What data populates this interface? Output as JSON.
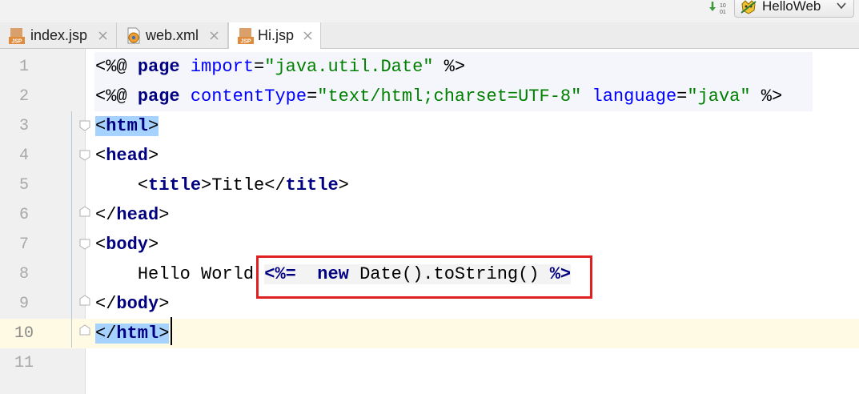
{
  "toolbar": {
    "vcs_icon": "vcs-update-icon",
    "run_config": {
      "label": "HelloWeb",
      "icon": "tomcat-icon"
    }
  },
  "tabs": [
    {
      "label": "index.jsp",
      "icon": "jsp-file-icon",
      "active": false
    },
    {
      "label": "web.xml",
      "icon": "xml-file-icon",
      "active": false
    },
    {
      "label": "Hi.jsp",
      "icon": "jsp-file-icon",
      "active": true
    }
  ],
  "editor": {
    "line_numbers": [
      "1",
      "2",
      "3",
      "4",
      "5",
      "6",
      "7",
      "8",
      "9",
      "10",
      "11"
    ],
    "current_line": 10,
    "lines": {
      "l1": {
        "open": "<%@ ",
        "kw": "page",
        "attr": "import",
        "eq": "=",
        "val": "\"java.util.Date\"",
        "close": " %>"
      },
      "l2": {
        "open": "<%@ ",
        "kw": "page",
        "attr1": "contentType",
        "eq1": "=",
        "val1": "\"text/html;charset=UTF-8\"",
        "attr2": "language",
        "eq2": "=",
        "val2": "\"java\"",
        "close": " %>"
      },
      "l3": {
        "lt": "<",
        "tag": "html",
        "gt": ">"
      },
      "l4": {
        "lt": "<",
        "tag": "head",
        "gt": ">"
      },
      "l5": {
        "indent": "    ",
        "lt1": "<",
        "tag1": "title",
        "gt1": ">",
        "text": "Title",
        "lt2": "</",
        "tag2": "title",
        "gt2": ">"
      },
      "l6": {
        "lt": "</",
        "tag": "head",
        "gt": ">"
      },
      "l7": {
        "lt": "<",
        "tag": "body",
        "gt": ">"
      },
      "l8": {
        "indent": "    ",
        "text": "Hello World ",
        "open": "<%=",
        "space": "  ",
        "kw": "new",
        "expr": " Date().toString() ",
        "close": "%>"
      },
      "l9": {
        "lt": "</",
        "tag": "body",
        "gt": ">"
      },
      "l10": {
        "lt": "</",
        "tag": "html",
        "gt": ">"
      }
    }
  },
  "colors": {
    "keyword": "#000080",
    "string": "#008000",
    "attribute": "#0000ff",
    "tag_match_highlight": "#a6d2ff",
    "current_line": "#fffae3",
    "annotation": "#e02020"
  }
}
